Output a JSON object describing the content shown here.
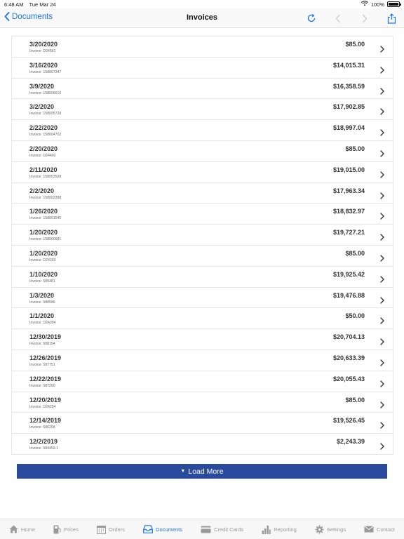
{
  "status": {
    "time": "6:48 AM",
    "date": "Tue Mar 24",
    "battery": "100%"
  },
  "nav": {
    "back_label": "Documents",
    "title": "Invoices"
  },
  "invoice_prefix": "Invoice:",
  "invoices": [
    {
      "date": "3/20/2020",
      "invoice": "Invoice: D24561",
      "amount": "$85.00"
    },
    {
      "date": "3/16/2020",
      "invoice": "Invoice: 158007347",
      "amount": "$14,015.31"
    },
    {
      "date": "3/9/2020",
      "invoice": "Invoice: 158006610",
      "amount": "$16,358.59"
    },
    {
      "date": "3/2/2020",
      "invoice": "Invoice: 158005728",
      "amount": "$17,902.85"
    },
    {
      "date": "2/22/2020",
      "invoice": "Invoice: 158004702",
      "amount": "$18,997.04"
    },
    {
      "date": "2/20/2020",
      "invoice": "Invoice: D24492",
      "amount": "$85.00"
    },
    {
      "date": "2/11/2020",
      "invoice": "Invoice: 158003528",
      "amount": "$19,015.00"
    },
    {
      "date": "2/2/2020",
      "invoice": "Invoice: 158002398",
      "amount": "$17,963.34"
    },
    {
      "date": "1/26/2020",
      "invoice": "Invoice: 158001545",
      "amount": "$18,832.97"
    },
    {
      "date": "1/20/2020",
      "invoice": "Invoice: 158000681",
      "amount": "$19,727.21"
    },
    {
      "date": "1/20/2020",
      "invoice": "Invoice: D24393",
      "amount": "$85.00"
    },
    {
      "date": "1/10/2020",
      "invoice": "Invoice: 589481",
      "amount": "$19,925.42"
    },
    {
      "date": "1/3/2020",
      "invoice": "Invoice: 588586",
      "amount": "$19,476.88"
    },
    {
      "date": "1/1/2020",
      "invoice": "Invoice: D24294",
      "amount": "$50.00"
    },
    {
      "date": "12/30/2019",
      "invoice": "Invoice: 588154",
      "amount": "$20,704.13"
    },
    {
      "date": "12/26/2019",
      "invoice": "Invoice: 587751",
      "amount": "$20,633.39"
    },
    {
      "date": "12/22/2019",
      "invoice": "Invoice: 587290",
      "amount": "$20,055.43"
    },
    {
      "date": "12/20/2019",
      "invoice": "Invoice: D24254",
      "amount": "$85.00"
    },
    {
      "date": "12/14/2019",
      "invoice": "Invoice: 586268",
      "amount": "$19,526.45"
    },
    {
      "date": "12/2/2019",
      "invoice": "Invoice: 584459.1",
      "amount": "$2,243.39"
    }
  ],
  "load_more_label": "Load More",
  "tabs": [
    {
      "label": "Home",
      "icon": "home-icon"
    },
    {
      "label": "Prices",
      "icon": "gas-pump-icon"
    },
    {
      "label": "Orders",
      "icon": "calendar-icon"
    },
    {
      "label": "Documents",
      "icon": "inbox-icon"
    },
    {
      "label": "Credit Cards",
      "icon": "credit-card-icon"
    },
    {
      "label": "Reporting",
      "icon": "bar-chart-icon"
    },
    {
      "label": "Settings",
      "icon": "gear-icon"
    },
    {
      "label": "Contact",
      "icon": "envelope-icon"
    }
  ],
  "active_tab": "Documents",
  "colors": {
    "accent": "#1a73e8",
    "load_more_bg": "#2a4a9b",
    "inactive_tab": "#9a9a9a"
  }
}
